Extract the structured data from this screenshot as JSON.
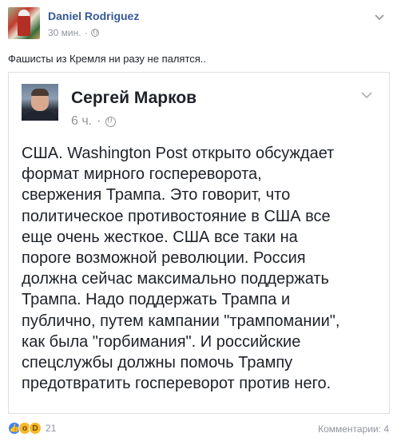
{
  "post": {
    "author": "Daniel Rodriguez",
    "time": "30 мин.",
    "separator": "·",
    "text": "Фашисты из Кремля ни разу не палятся..",
    "icons": {
      "audience": "globe-icon",
      "menu": "chevron-down-icon"
    }
  },
  "shared_card": {
    "author": "Сергей Марков",
    "time": "6 ч.",
    "separator": "·",
    "body_lines": [
      "США. Washington Post открыто обсуждает",
      "формат мирного госпереворота,",
      "свержения Трампа. Это говорит, что",
      "политическое противостояние в США все",
      "еще очень жесткое. США все таки на",
      "пороге возможной революции. Россия",
      "должна сейчас максимально поддержать",
      "Трампа. Надо поддержать Трампа и",
      "публично, путем кампании \"трампомании\",",
      "как была \"горбимания\". И российские",
      "спецслужбы должны помочь Трампу",
      "предотвратить госпереворот против него."
    ]
  },
  "footer": {
    "reaction_icons": [
      "like-icon",
      "wow-icon",
      "haha-icon"
    ],
    "reaction_count": "21",
    "comments": "Комментарии: 4"
  },
  "colors": {
    "link_blue": "#365899",
    "meta_gray": "#90949c",
    "text": "#1d2129",
    "border": "#dddfe2",
    "like_blue": "#4080ff"
  }
}
